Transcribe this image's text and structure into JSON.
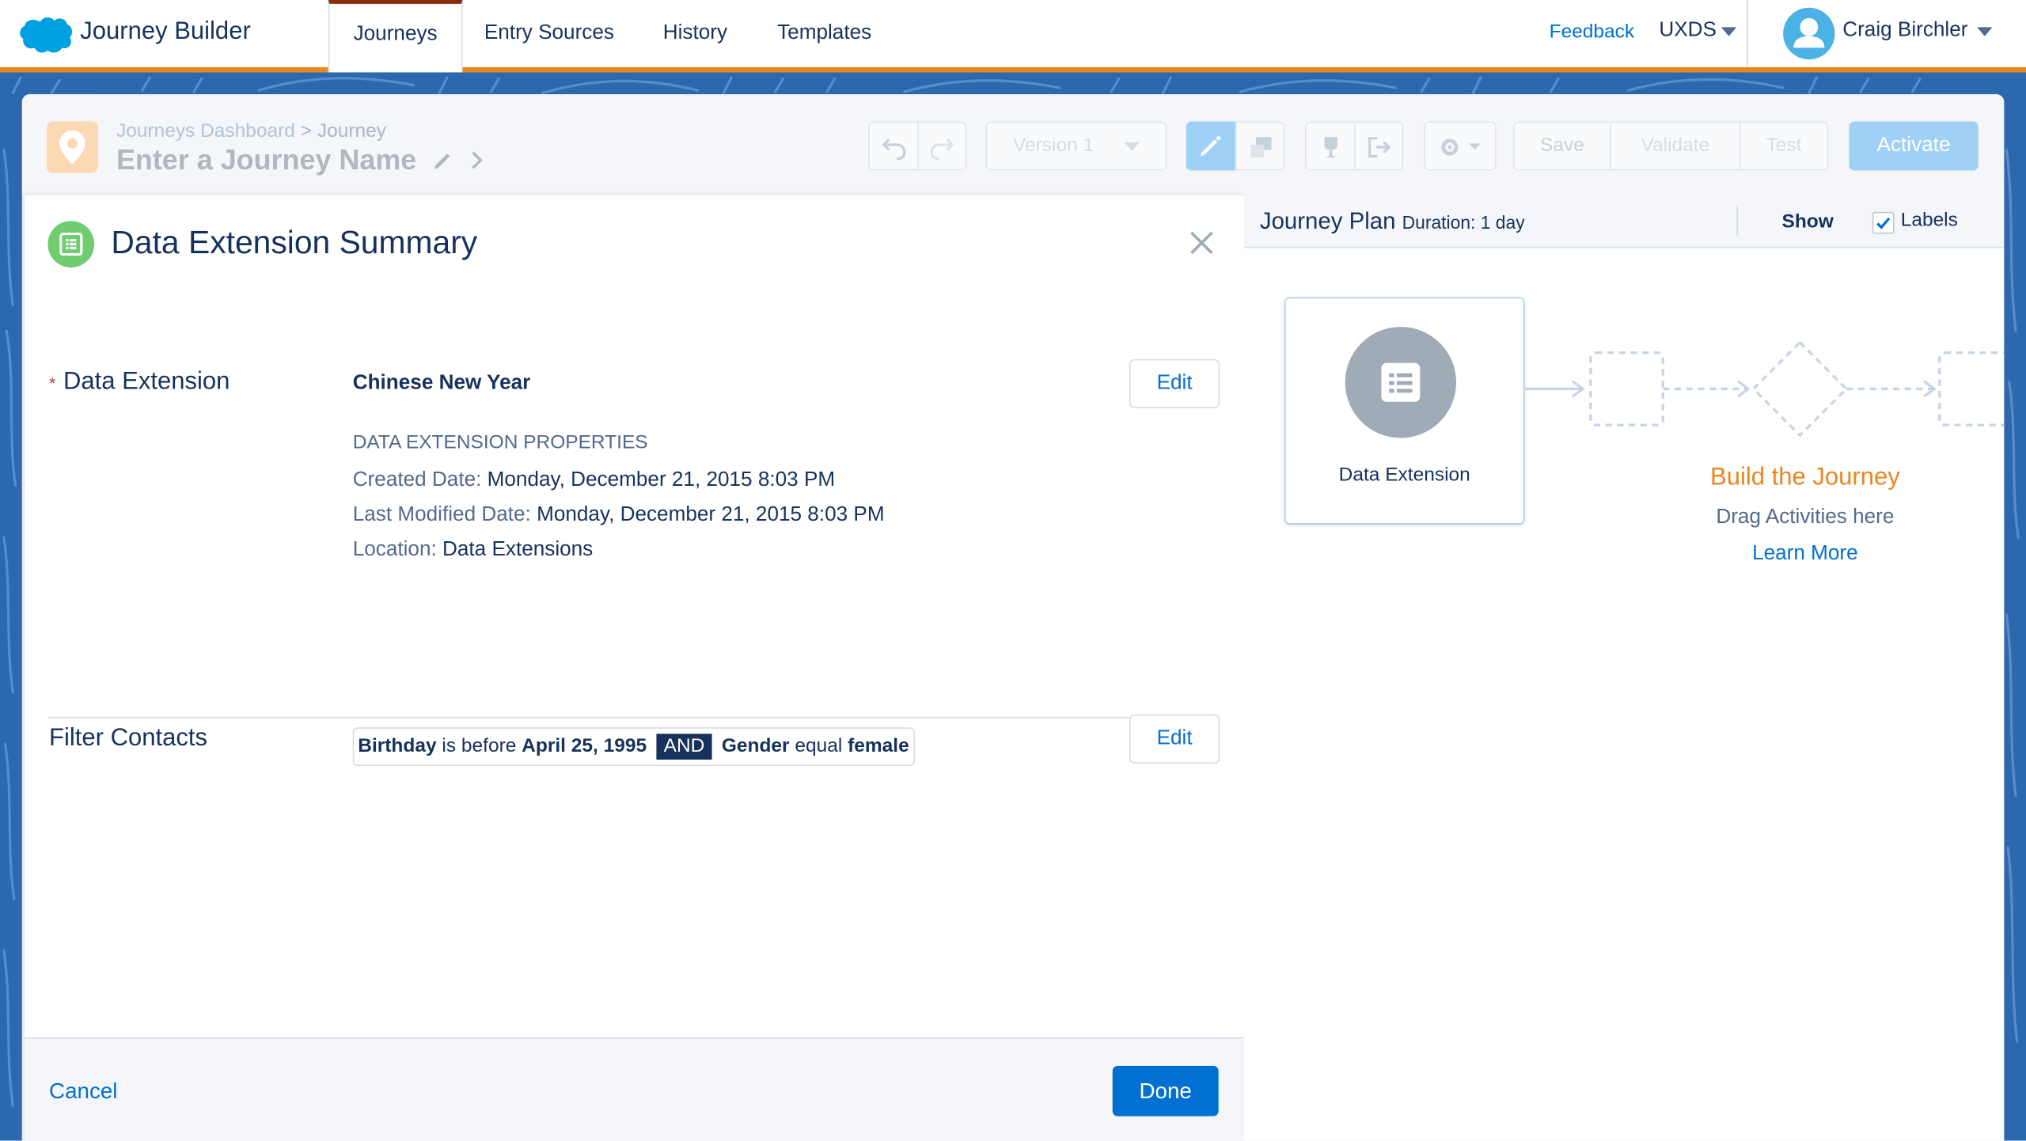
{
  "app": {
    "title": "Journey Builder",
    "brand_color": "#00a1e0",
    "accent_color": "#e8871e"
  },
  "nav": {
    "tabs": [
      {
        "label": "Journeys",
        "active": true
      },
      {
        "label": "Entry Sources",
        "active": false
      },
      {
        "label": "History",
        "active": false
      },
      {
        "label": "Templates",
        "active": false
      }
    ],
    "feedback": "Feedback",
    "org_switcher": "UXDS",
    "user_name": "Craig Birchler"
  },
  "journey": {
    "breadcrumb": {
      "parent": "Journeys Dashboard",
      "separator": ">",
      "current": "Journey"
    },
    "name_placeholder": "Enter a Journey Name",
    "toolbar": {
      "version": "Version 1",
      "save": "Save",
      "validate": "Validate",
      "test": "Test",
      "activate": "Activate"
    }
  },
  "summary_panel": {
    "title": "Data Extension Summary",
    "data_extension": {
      "label": "Data Extension",
      "required_marker": "*",
      "name": "Chinese New Year",
      "edit_label": "Edit",
      "properties_heading": "DATA EXTENSION PROPERTIES",
      "properties": [
        {
          "key": "Created Date:",
          "value": "Monday, December 21, 2015 8:03 PM"
        },
        {
          "key": "Last Modified Date:",
          "value": "Monday, December 21, 2015 8:03 PM"
        },
        {
          "key": "Location:",
          "value": "Data Extensions"
        }
      ]
    },
    "filter": {
      "label": "Filter Contacts",
      "edit_label": "Edit",
      "clause1_field": "Birthday",
      "clause1_op": "is before",
      "clause1_value": "April 25, 1995",
      "conjunction": "AND",
      "clause2_field": "Gender",
      "clause2_op": "equal",
      "clause2_value": "female"
    },
    "footer": {
      "cancel": "Cancel",
      "done": "Done"
    }
  },
  "plan": {
    "title": "Journey Plan",
    "duration": "Duration: 1 day",
    "show_label": "Show",
    "labels_label": "Labels",
    "labels_checked": true,
    "entry_node_label": "Data Extension",
    "build_title": "Build the Journey",
    "build_subtitle": "Drag Activities here",
    "learn_more": "Learn More"
  }
}
